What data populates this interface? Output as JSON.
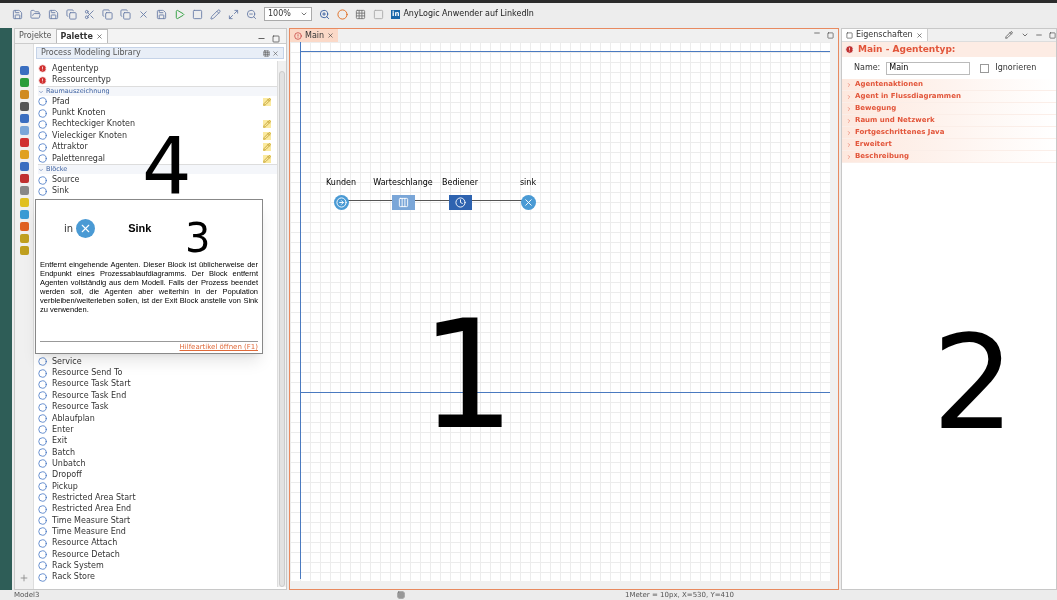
{
  "toolbar": {
    "zoom": "100%",
    "linkedin_badge": "in",
    "link": "AnyLogic Anwender auf LinkedIn"
  },
  "left_panel": {
    "tabs": [
      {
        "label": "Projekte",
        "selected": false
      },
      {
        "label": "Palette",
        "selected": true
      }
    ],
    "palette_title": "Process Modeling Library",
    "items_top": [
      {
        "label": "Agententyp"
      },
      {
        "label": "Ressourcentyp"
      }
    ],
    "sections": [
      {
        "title": "Raumauszeichnung",
        "expanded": true,
        "items": [
          {
            "label": "Pfad",
            "editable": true
          },
          {
            "label": "Punkt Knoten",
            "editable": false
          },
          {
            "label": "Rechteckiger Knoten",
            "editable": true
          },
          {
            "label": "Vieleckiger Knoten",
            "editable": true
          },
          {
            "label": "Attraktor",
            "editable": true
          },
          {
            "label": "Palettenregal",
            "editable": true
          }
        ]
      },
      {
        "title": "Blöcke",
        "expanded": true,
        "items": [
          {
            "label": "Source",
            "editable": false
          },
          {
            "label": "Sink",
            "editable": false
          }
        ]
      }
    ],
    "items_below_popup": [
      "Service",
      "Resource Send To",
      "Resource Task Start",
      "Resource Task End",
      "Resource Task",
      "Ablaufplan",
      "Enter",
      "Exit",
      "Batch",
      "Unbatch",
      "Dropoff",
      "Pickup",
      "Restricted Area Start",
      "Restricted Area End",
      "Time Measure Start",
      "Time Measure End",
      "Resource Attach",
      "Resource Detach",
      "Rack System",
      "Rack Store"
    ]
  },
  "popup": {
    "port_label": "in",
    "title": "Sink",
    "description": "Entfernt eingehende Agenten. Dieser Block ist üblicherweise der Endpunkt eines Prozessablaufdiagramms. Der Block entfernt Agenten vollständig aus dem Modell. Falls der Prozess beendet werden soll, die Agenten aber weiterhin in der Population verbleiben/weiterleben sollen, ist der Exit Block anstelle von Sink zu verwenden.",
    "link": "Hilfeartikel öffnen (F1)"
  },
  "editor": {
    "tab": "Main",
    "nodes": [
      {
        "label": "Kunden",
        "kind": "source"
      },
      {
        "label": "Warteschlange",
        "kind": "queue"
      },
      {
        "label": "Bediener",
        "kind": "delay"
      },
      {
        "label": "sink",
        "kind": "sink"
      }
    ]
  },
  "properties": {
    "tab": "Eigenschaften",
    "heading": "Main - Agententyp:",
    "name_label": "Name:",
    "name_value": "Main",
    "ignore": {
      "label": "Ignorieren",
      "checked": false
    },
    "sections": [
      {
        "label": "Agentenaktionen",
        "expanded": false
      },
      {
        "label": "Agent in Flussdiagrammen",
        "expanded": false
      },
      {
        "label": "Bewegung",
        "expanded": false
      },
      {
        "label": "Raum und Netzwerk",
        "expanded": false
      },
      {
        "label": "Fortgeschrittenes Java",
        "expanded": false
      },
      {
        "label": "Erweitert",
        "expanded": false
      },
      {
        "label": "Beschreibung",
        "expanded": false
      }
    ]
  },
  "status_bar": {
    "model": "Model3",
    "coordinates": "1Meter = 10px, X=530, Y=410"
  },
  "annotations": [
    "1",
    "2",
    "3",
    "4"
  ]
}
